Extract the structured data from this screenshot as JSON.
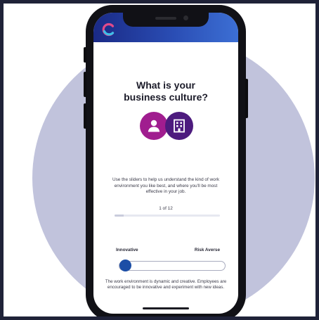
{
  "question": {
    "title_line1": "What is your",
    "title_line2": "business culture?"
  },
  "icons": {
    "left": "person-icon",
    "right": "building-icon"
  },
  "description": "Use the sliders to help us understand the kind of work environment you like best, and where you'll be most effective in your job.",
  "progress": {
    "label": "1 of 12",
    "current": 1,
    "total": 12
  },
  "slider": {
    "left_label": "Innovative",
    "right_label": "Risk Averse",
    "value": 0
  },
  "statement": "The work environment is dynamic and creative. Employees are encouraged to be innovative and experiment with new ideas.",
  "colors": {
    "header_start": "#1a2a86",
    "header_end": "#3c6fd4",
    "person_circle": "#a01d8f",
    "building_circle": "#4d1b7e",
    "slider_thumb": "#1c4ea6"
  }
}
